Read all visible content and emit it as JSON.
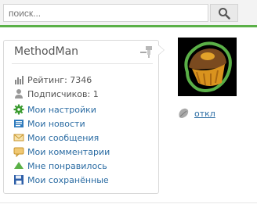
{
  "search": {
    "placeholder": "поиск..."
  },
  "profile": {
    "username": "MethodMan",
    "rating": "Рейтинг: 7346",
    "subscribers": "Подписчиков: 1"
  },
  "menu": [
    {
      "label": "Мои настройки",
      "icon": "gear-icon",
      "color": "#3a9b2f"
    },
    {
      "label": "Мои новости",
      "icon": "news-icon",
      "color": "#2e7bbd"
    },
    {
      "label": "Мои сообщения",
      "icon": "envelope-icon",
      "color": "#d9a441"
    },
    {
      "label": "Мои комментарии",
      "icon": "comment-icon",
      "color": "#e0a84a"
    },
    {
      "label": "Мне понравилось",
      "icon": "thumb-up-icon",
      "color": "#5ab047"
    },
    {
      "label": "Мои сохранённые",
      "icon": "floppy-icon",
      "color": "#2e5fa8"
    }
  ],
  "status": {
    "link_label": "откл"
  },
  "colors": {
    "accent": "#5ab047",
    "link": "#2b6ca3"
  }
}
